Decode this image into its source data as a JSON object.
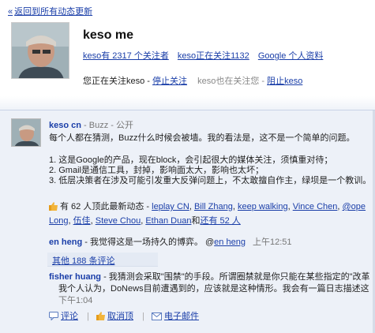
{
  "top": {
    "back_link": "返回到所有动态更新",
    "profile": {
      "name": "keso me",
      "stats": [
        "keso有 2317 个关注者",
        "keso正在关注1132",
        "Google 个人资料"
      ],
      "following_text": "您正在关注keso - ",
      "stop_following": "停止关注",
      "follows_you_text": "keso也在关注您 - ",
      "block": "阻止keso"
    }
  },
  "post": {
    "author": "keso cn",
    "meta": " - Buzz - 公开",
    "body": [
      "每个人都在猜测，Buzz什么时候会被墙。我的看法是，这不是一个简单的问题。",
      "1. 这是Google的产品，现在block，会引起很大的媒体关注，须慎重对待；",
      "2. Gmail是通信工具，封掉，影响面太大，影响也太坏；",
      "3. 低层决策者在涉及可能引发重大反弹问题上，不太敢擅自作主，绿坝是一个教训。"
    ],
    "likes": {
      "prefix": "有 62 人顶此最新动态",
      "names": [
        "leplay CN",
        "Bill Zhang",
        "keep walking",
        "Vince Chen",
        "@ope Long",
        "伍佳",
        "Steve Chou",
        "Ethan Duan"
      ],
      "and_text": "和",
      "more": "还有 52 人"
    },
    "comments": [
      {
        "author": "en heng",
        "text": " - 我觉得这是一场持久的博弈。 @",
        "mention": "en heng",
        "time": "上午12:51"
      },
      {
        "author": "fisher huang",
        "lines": [
          " - 我猜测会采取\"围禁\"的手段。所谓圈禁就是你只能在某些指定的\"改革",
          "我个人认为，DoNews目前遭遇到的，应该就是这种情形。我会有一篇日志描述这",
          "下午1:04"
        ]
      }
    ],
    "more_comments": "其他 188 条评论",
    "actions": [
      "评论",
      "取消顶",
      "电子邮件"
    ]
  }
}
